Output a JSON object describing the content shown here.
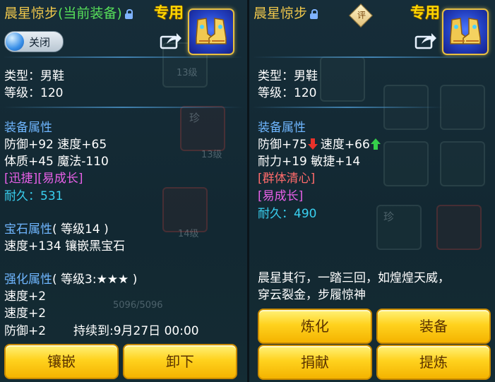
{
  "left_panel": {
    "title": "晨星惊步",
    "title_current": "(当前装备)",
    "exclusive": "专用",
    "toggle_label": "关闭",
    "type_line": "类型：男鞋",
    "level_line": "等级：120",
    "equip_attr_header": "装备属性",
    "attr_line1": "防御+92 速度+65",
    "attr_line2": "体质+45 魔法-110",
    "special_line": "[迅捷][易成长]",
    "durability_line": "耐久：531",
    "gem_header": "宝石属性",
    "gem_header_level": "( 等级14 )",
    "gem_line": "速度+134 镶嵌黑宝石",
    "enhance_header": "强化属性",
    "enhance_header_level": "( 等级3:★★★ )",
    "enhance_line1": "速度+2",
    "enhance_line2": "速度+2",
    "enhance_line3": "防御+2",
    "duration_text": "持续到:9月27日 00:00",
    "bg_text_levels": [
      "13级",
      "13级",
      "14级"
    ],
    "bg_text_gem": "珍",
    "bg_hp_text": "5096/5096",
    "buttons": {
      "inlay": "镶嵌",
      "unequip": "卸下"
    }
  },
  "right_panel": {
    "title": "晨星惊步",
    "rating_badge": "评",
    "exclusive": "专用",
    "type_line": "类型：男鞋",
    "level_line": "等级：120",
    "equip_attr_header": "装备属性",
    "attr_defense": "防御+75",
    "attr_speed": "速度+66",
    "attr_line2": "耐力+19 敏捷+14",
    "special1": "[群体清心]",
    "special2": "[易成长]",
    "durability_line": "耐久：490",
    "bg_text_gem": "珍",
    "desc_line1": "晨星其行，一踏三回，如煌煌天威，",
    "desc_line2": "穿云裂金，步履惊神",
    "buttons": {
      "refine": "炼化",
      "equip": "装备",
      "donate": "捐献",
      "extract": "提炼"
    }
  },
  "icons": [
    "lock-icon",
    "share-icon",
    "boots-item-icon",
    "arrow-down-icon",
    "arrow-up-icon",
    "rating-badge-icon"
  ],
  "colors": {
    "gold_title": "#f2c94c",
    "current_green": "#57e05a",
    "header_blue": "#6fb6ff",
    "magenta": "#e860e8",
    "cyan": "#39d0f0",
    "red": "#ff6b6b",
    "button_gold": "#ffd21e"
  }
}
